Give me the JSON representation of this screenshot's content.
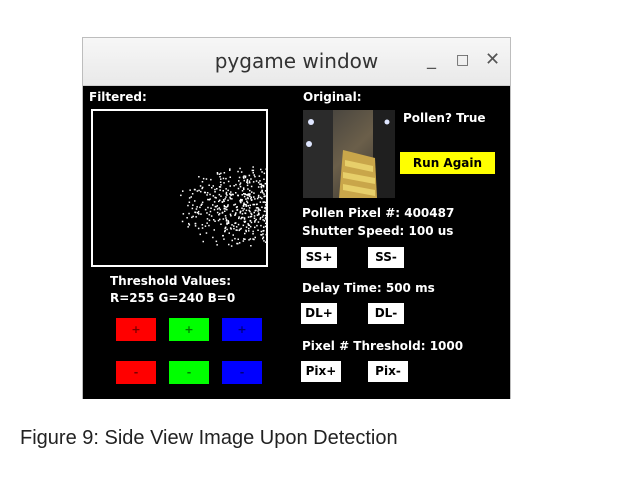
{
  "window": {
    "title": "pygame window",
    "minimize": "_",
    "maximize": "□",
    "close": "✕"
  },
  "filtered_label": "Filtered:",
  "original_label": "Original:",
  "pollen_status": "Pollen? True",
  "run_again_label": "Run Again",
  "pollen_pixel": "Pollen Pixel #: 400487",
  "shutter_speed": "Shutter Speed: 100 us",
  "ss_plus": "SS+",
  "ss_minus": "SS-",
  "delay_time": "Delay Time: 500 ms",
  "dl_plus": "DL+",
  "dl_minus": "DL-",
  "pixel_threshold": "Pixel # Threshold: 1000",
  "pix_plus": "Pix+",
  "pix_minus": "Pix-",
  "threshold_title": "Threshold Values:",
  "threshold_values": "R=255 G=240 B=0",
  "color_buttons": {
    "plus": "+",
    "minus": "-",
    "red": "#ff0000",
    "green": "#00ff00",
    "blue": "#0000ff"
  },
  "accent_yellow": "#ffff00",
  "caption": "Figure 9: Side View Image Upon Detection"
}
